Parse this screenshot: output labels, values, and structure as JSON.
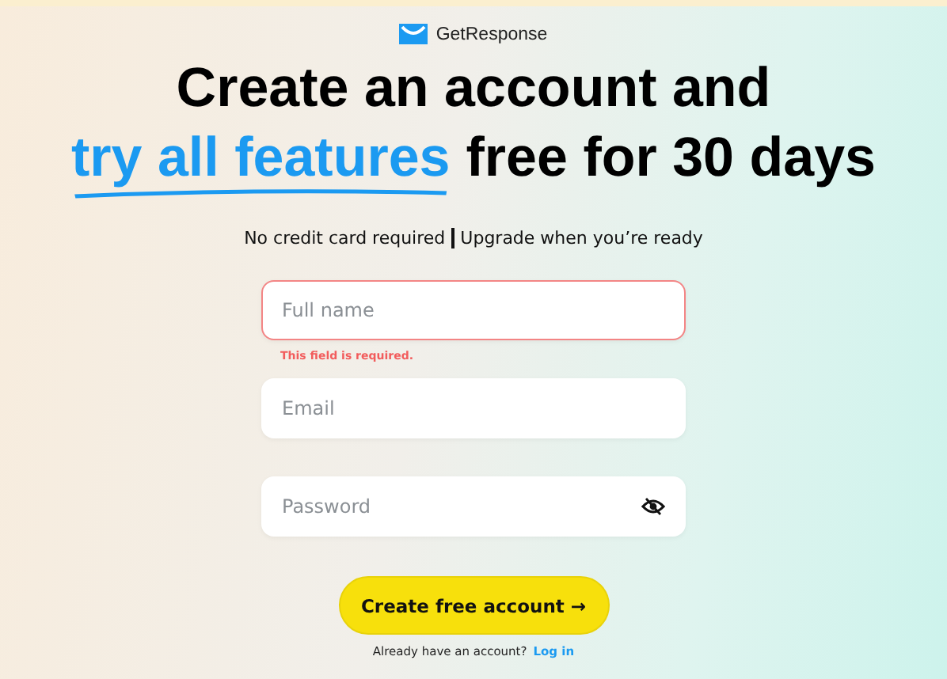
{
  "logo": {
    "text": "GetResponse"
  },
  "headline": {
    "line_1": "Create an account and",
    "highlight": "try all features",
    "rest": "free for 30 days"
  },
  "subtitle": {
    "left": "No credit card required",
    "right": "Upgrade when you’re ready"
  },
  "fields": [
    {
      "kind": "text",
      "placeholder": "Full name",
      "invalid": true,
      "error": "This field is required."
    },
    {
      "kind": "text",
      "placeholder": "Email",
      "invalid": false
    },
    {
      "kind": "password",
      "placeholder": "Password",
      "invalid": false
    }
  ],
  "submit": {
    "label": "Create free account →"
  },
  "login": {
    "prompt": "Already have an account?",
    "link": "Log in"
  }
}
